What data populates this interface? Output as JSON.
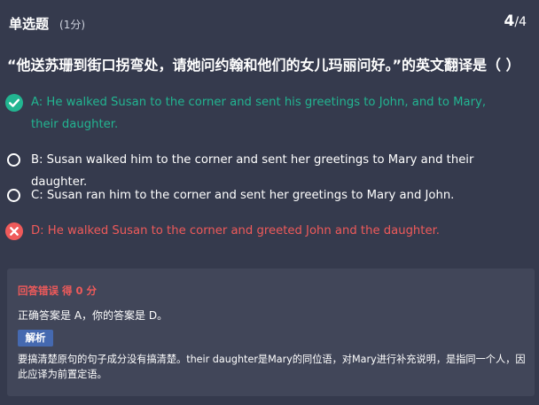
{
  "header": {
    "type_label": "单选题",
    "score_label": "(1分)",
    "progress_current": "4",
    "progress_total": "/4"
  },
  "question": {
    "text": "“他送苏珊到街口拐弯处，请她问约翰和他们的女儿玛丽问好。”的英文翻译是（  ）"
  },
  "options": [
    {
      "text": "A: He walked Susan to the corner and sent his greetings to John, and to Mary, their daughter.",
      "state": "correct",
      "icon": "check-circle-icon"
    },
    {
      "text": "B: Susan walked him to the corner and sent her greetings to Mary and their daughter.",
      "state": "unselected",
      "icon": "radio-icon"
    },
    {
      "text": "C: Susan ran him to the corner and sent her greetings to Mary and John.",
      "state": "unselected",
      "icon": "radio-icon"
    },
    {
      "text": "D: He walked Susan to the corner and greeted John and the daughter.",
      "state": "wrong",
      "icon": "x-circle-icon"
    }
  ],
  "result": {
    "verdict": "回答错误 得 0 分",
    "answer_text": "正确答案是 A，你的答案是 D。",
    "analysis_label": "解析",
    "explanation": "要搞清楚原句的句子成分没有搞清楚。their daughter是Mary的同位语，对Mary进行补充说明，是指同一个人，因此应译为前置定语。"
  },
  "colors": {
    "background": "#353a4d",
    "panel": "#414659",
    "correct": "#22b591",
    "wrong": "#ef5a5a",
    "button": "#4569b0"
  }
}
